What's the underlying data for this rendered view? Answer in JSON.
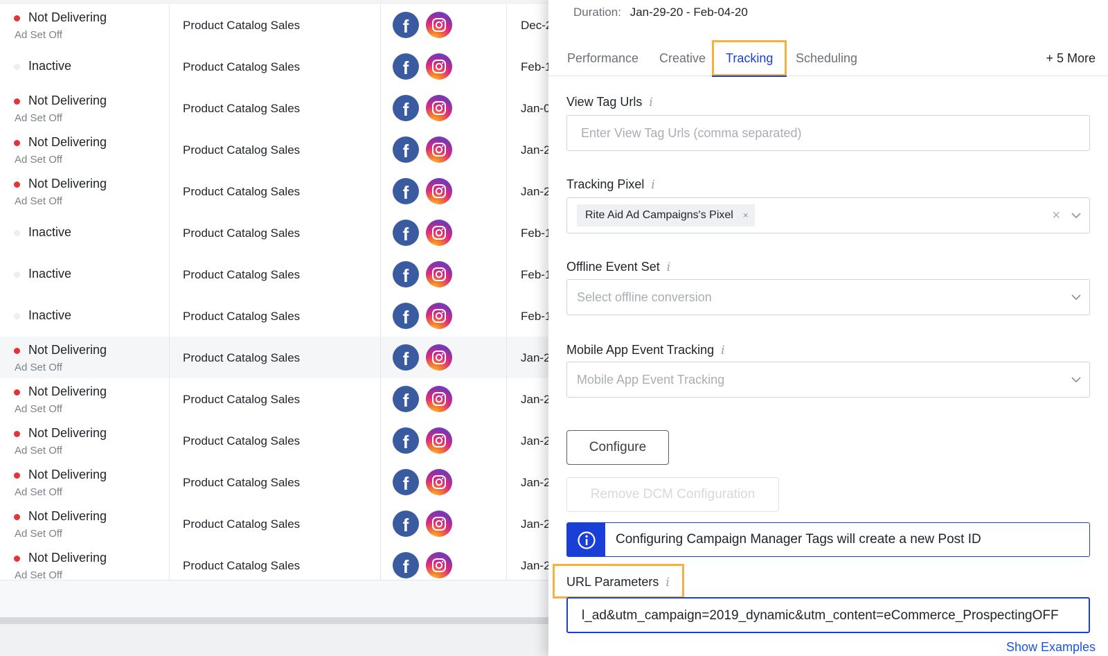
{
  "table": {
    "rows": [
      {
        "status": "Not Delivering",
        "sub": "Ad Set Off",
        "dot": "red",
        "objective": "Product Catalog Sales",
        "date": "Dec-2"
      },
      {
        "status": "Inactive",
        "sub": "",
        "dot": "grey",
        "objective": "Product Catalog Sales",
        "date": "Feb-1"
      },
      {
        "status": "Not Delivering",
        "sub": "Ad Set Off",
        "dot": "red",
        "objective": "Product Catalog Sales",
        "date": "Jan-0"
      },
      {
        "status": "Not Delivering",
        "sub": "Ad Set Off",
        "dot": "red",
        "objective": "Product Catalog Sales",
        "date": "Jan-2"
      },
      {
        "status": "Not Delivering",
        "sub": "Ad Set Off",
        "dot": "red",
        "objective": "Product Catalog Sales",
        "date": "Jan-2"
      },
      {
        "status": "Inactive",
        "sub": "",
        "dot": "grey",
        "objective": "Product Catalog Sales",
        "date": "Feb-1"
      },
      {
        "status": "Inactive",
        "sub": "",
        "dot": "grey",
        "objective": "Product Catalog Sales",
        "date": "Feb-1"
      },
      {
        "status": "Inactive",
        "sub": "",
        "dot": "grey",
        "objective": "Product Catalog Sales",
        "date": "Feb-1"
      },
      {
        "status": "Not Delivering",
        "sub": "Ad Set Off",
        "dot": "red",
        "objective": "Product Catalog Sales",
        "date": "Jan-2",
        "highlighted": true
      },
      {
        "status": "Not Delivering",
        "sub": "Ad Set Off",
        "dot": "red",
        "objective": "Product Catalog Sales",
        "date": "Jan-2"
      },
      {
        "status": "Not Delivering",
        "sub": "Ad Set Off",
        "dot": "red",
        "objective": "Product Catalog Sales",
        "date": "Jan-2"
      },
      {
        "status": "Not Delivering",
        "sub": "Ad Set Off",
        "dot": "red",
        "objective": "Product Catalog Sales",
        "date": "Jan-2"
      },
      {
        "status": "Not Delivering",
        "sub": "Ad Set Off",
        "dot": "red",
        "objective": "Product Catalog Sales",
        "date": "Jan-2"
      },
      {
        "status": "Not Delivering",
        "sub": "Ad Set Off",
        "dot": "red",
        "objective": "Product Catalog Sales",
        "date": "Jan-2"
      }
    ],
    "channel_icons": [
      "facebook-icon",
      "instagram-icon"
    ]
  },
  "panel": {
    "duration_label": "Duration:",
    "duration_value": "Jan-29-20 - Feb-04-20",
    "tabs": [
      {
        "label": "Performance",
        "active": false
      },
      {
        "label": "Creative",
        "active": false
      },
      {
        "label": "Tracking",
        "active": true
      },
      {
        "label": "Scheduling",
        "active": false
      }
    ],
    "more_tabs": "+ 5 More",
    "info_glyph": "i",
    "view_tag": {
      "label": "View Tag Urls",
      "placeholder": "Enter View Tag Urls (comma separated)"
    },
    "tracking_pixel": {
      "label": "Tracking Pixel",
      "tag": "Rite Aid Ad Campaigns's Pixel",
      "tag_remove": "×",
      "clear": "×"
    },
    "offline_event": {
      "label": "Offline Event Set",
      "placeholder": "Select offline conversion"
    },
    "mobile_app": {
      "label": "Mobile App Event Tracking",
      "placeholder": "Mobile App Event Tracking"
    },
    "configure_label": "Configure",
    "remove_dcm_label": "Remove DCM Configuration",
    "info_banner": "Configuring Campaign Manager Tags will create a new Post ID",
    "url_params": {
      "label": "URL Parameters",
      "value": "l_ad&utm_campaign=2019_dynamic&utm_content=eCommerce_ProspectingOFF"
    },
    "show_examples": "Show Examples"
  },
  "colors": {
    "accent": "#1a3fd6",
    "highlight": "#f5b041",
    "status_red": "#e0363a",
    "facebook": "#3b5ba0"
  }
}
